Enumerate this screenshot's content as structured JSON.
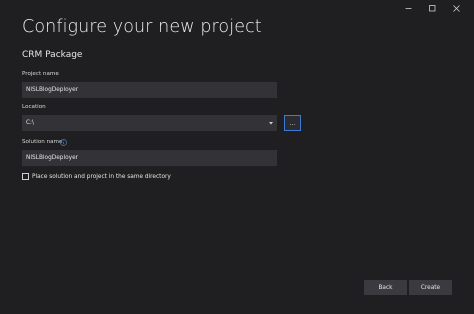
{
  "window": {
    "minimize_label": "minimize",
    "maximize_label": "maximize",
    "close_label": "close"
  },
  "header": {
    "title": "Configure your new project",
    "template_name": "CRM Package"
  },
  "form": {
    "project_name_label": "Project name",
    "project_name_value": "NISLBlogDeployer",
    "location_label": "Location",
    "location_value": "C:\\",
    "browse_label": "...",
    "solution_name_label": "Solution name",
    "solution_name_value": "NISLBlogDeployer",
    "same_directory_label": "Place solution and project in the same directory",
    "same_directory_checked": false
  },
  "footer": {
    "back_label": "Back",
    "create_label": "Create"
  },
  "colors": {
    "background": "#1f1f21",
    "field": "#333337",
    "accent": "#3e7bd6",
    "button": "#3a3a3f"
  }
}
